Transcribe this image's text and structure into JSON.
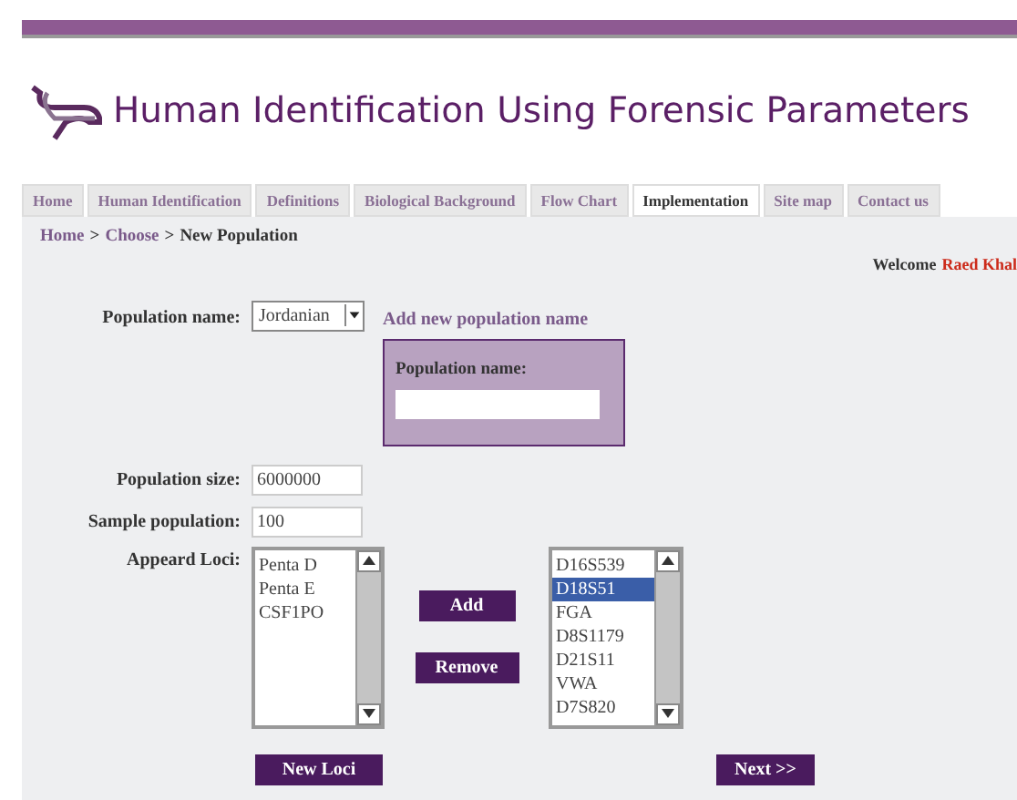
{
  "header": {
    "title": "Human Identification Using Forensic Parameters"
  },
  "tabs": [
    {
      "label": "Home",
      "selected": false
    },
    {
      "label": "Human Identification",
      "selected": false
    },
    {
      "label": "Definitions",
      "selected": false
    },
    {
      "label": "Biological Background",
      "selected": false
    },
    {
      "label": "Flow Chart",
      "selected": false
    },
    {
      "label": "Implementation",
      "selected": true
    },
    {
      "label": "Site map",
      "selected": false
    },
    {
      "label": "Contact us",
      "selected": false
    }
  ],
  "breadcrumb": [
    {
      "label": "Home",
      "link": true
    },
    {
      "label": "Choose",
      "link": true
    },
    {
      "label": "New Population",
      "link": false
    }
  ],
  "breadcrumb_separator": ">",
  "welcome": {
    "text": "Welcome",
    "user": "Raed Khal"
  },
  "form": {
    "population_name": {
      "label": "Population name:",
      "value": "Jordanian"
    },
    "add_link": "Add new population name",
    "new_population": {
      "label": "Population name:"
    },
    "population_size": {
      "label": "Population size:",
      "value": "6000000"
    },
    "sample_population": {
      "label": "Sample population:",
      "value": "100"
    },
    "loci": {
      "label": "Appeard Loci:",
      "appeared": [
        {
          "label": "Penta D",
          "selected": false
        },
        {
          "label": "Penta E",
          "selected": false
        },
        {
          "label": "CSF1PO",
          "selected": false
        }
      ],
      "available": [
        {
          "label": "D16S539",
          "selected": false
        },
        {
          "label": "D18S51",
          "selected": true
        },
        {
          "label": "FGA",
          "selected": false
        },
        {
          "label": "D8S1179",
          "selected": false
        },
        {
          "label": "D21S11",
          "selected": false
        },
        {
          "label": "VWA",
          "selected": false
        },
        {
          "label": "D7S820",
          "selected": false
        }
      ],
      "add": "Add",
      "remove": "Remove"
    },
    "buttons": [
      "New Loci",
      "Next >>"
    ]
  }
}
